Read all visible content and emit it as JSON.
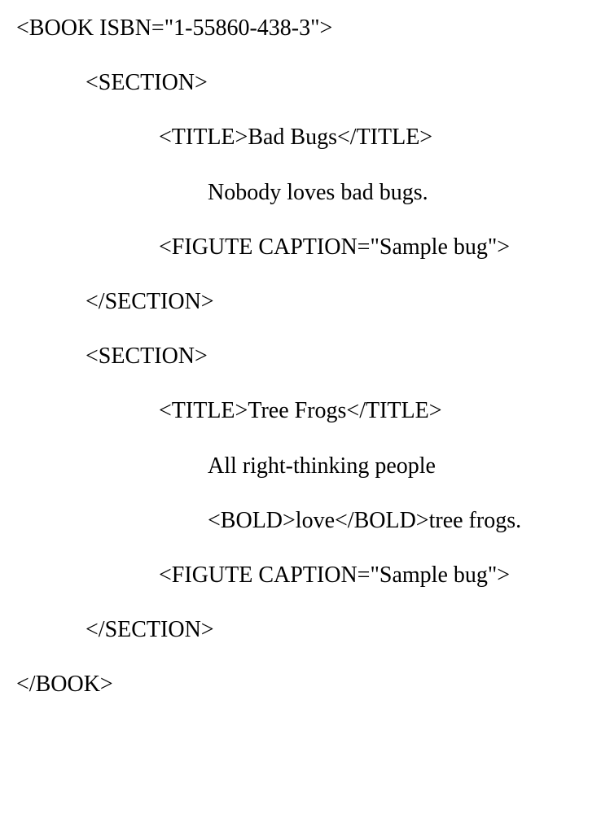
{
  "lines": {
    "book_open": "<BOOK ISBN=\"1-55860-438-3\">",
    "section1_open": "<SECTION>",
    "title1": "<TITLE>Bad Bugs</TITLE>",
    "text1": "Nobody loves bad bugs.",
    "figure1": "<FIGUTE CAPTION=\"Sample bug\">",
    "section1_close": "</SECTION>",
    "section2_open": "<SECTION>",
    "title2": "<TITLE>Tree Frogs</TITLE>",
    "text2a": "All right-thinking people",
    "text2b": "<BOLD>love</BOLD>tree frogs.",
    "figure2": "<FIGUTE CAPTION=\"Sample bug\">",
    "section2_close": "</SECTION>",
    "book_close": "</BOOK>"
  }
}
